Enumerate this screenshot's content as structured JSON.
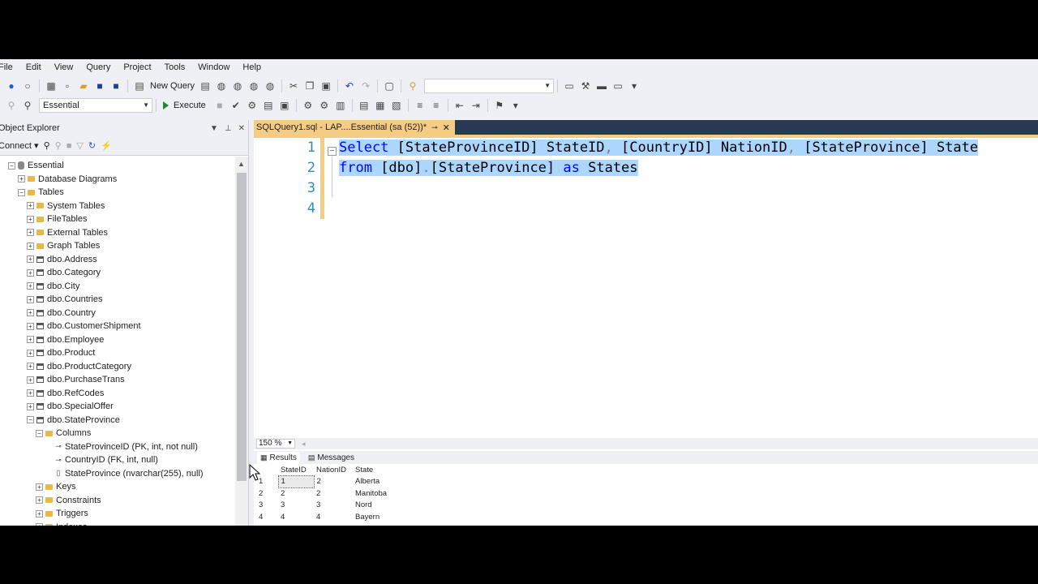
{
  "menu": [
    "File",
    "Edit",
    "View",
    "Query",
    "Project",
    "Tools",
    "Window",
    "Help"
  ],
  "toolbar1": {
    "new_query": "New Query",
    "search_value": ""
  },
  "toolbar2": {
    "database": "Essential",
    "execute": "Execute"
  },
  "object_explorer": {
    "title": "Object Explorer",
    "connect": "Connect",
    "tree": [
      {
        "label": "Essential",
        "level": 1,
        "expander": "-",
        "icon": "database-icon"
      },
      {
        "label": "Database Diagrams",
        "level": 2,
        "expander": "+",
        "icon": "folder-icon"
      },
      {
        "label": "Tables",
        "level": 2,
        "expander": "-",
        "icon": "folder-icon"
      },
      {
        "label": "System Tables",
        "level": 3,
        "expander": "+",
        "icon": "folder-icon"
      },
      {
        "label": "FileTables",
        "level": 3,
        "expander": "+",
        "icon": "folder-icon"
      },
      {
        "label": "External Tables",
        "level": 3,
        "expander": "+",
        "icon": "folder-icon"
      },
      {
        "label": "Graph Tables",
        "level": 3,
        "expander": "+",
        "icon": "folder-icon"
      },
      {
        "label": "dbo.Address",
        "level": 3,
        "expander": "+",
        "icon": "table-icon"
      },
      {
        "label": "dbo.Category",
        "level": 3,
        "expander": "+",
        "icon": "table-icon"
      },
      {
        "label": "dbo.City",
        "level": 3,
        "expander": "+",
        "icon": "table-icon"
      },
      {
        "label": "dbo.Countries",
        "level": 3,
        "expander": "+",
        "icon": "table-icon"
      },
      {
        "label": "dbo.Country",
        "level": 3,
        "expander": "+",
        "icon": "table-icon"
      },
      {
        "label": "dbo.CustomerShipment",
        "level": 3,
        "expander": "+",
        "icon": "table-icon"
      },
      {
        "label": "dbo.Employee",
        "level": 3,
        "expander": "+",
        "icon": "table-icon"
      },
      {
        "label": "dbo.Product",
        "level": 3,
        "expander": "+",
        "icon": "table-icon"
      },
      {
        "label": "dbo.ProductCategory",
        "level": 3,
        "expander": "+",
        "icon": "table-icon"
      },
      {
        "label": "dbo.PurchaseTrans",
        "level": 3,
        "expander": "+",
        "icon": "table-icon"
      },
      {
        "label": "dbo.RefCodes",
        "level": 3,
        "expander": "+",
        "icon": "table-icon"
      },
      {
        "label": "dbo.SpecialOffer",
        "level": 3,
        "expander": "+",
        "icon": "table-icon"
      },
      {
        "label": "dbo.StateProvince",
        "level": 3,
        "expander": "-",
        "icon": "table-icon"
      },
      {
        "label": "Columns",
        "level": 4,
        "expander": "-",
        "icon": "folder-icon"
      },
      {
        "label": "StateProvinceID (PK, int, not null)",
        "level": 5,
        "expander": "",
        "icon": "primary-key-icon"
      },
      {
        "label": "CountryID (FK, int, null)",
        "level": 5,
        "expander": "",
        "icon": "foreign-key-icon"
      },
      {
        "label": "StateProvince (nvarchar(255), null)",
        "level": 5,
        "expander": "",
        "icon": "column-icon"
      },
      {
        "label": "Keys",
        "level": 4,
        "expander": "+",
        "icon": "folder-icon"
      },
      {
        "label": "Constraints",
        "level": 4,
        "expander": "+",
        "icon": "folder-icon"
      },
      {
        "label": "Triggers",
        "level": 4,
        "expander": "+",
        "icon": "folder-icon"
      },
      {
        "label": "Indexes",
        "level": 4,
        "expander": "+",
        "icon": "folder-icon"
      }
    ]
  },
  "editor": {
    "tab_label": "SQLQuery1.sql - LAP....Essential (sa (52))*",
    "line_numbers": [
      "1",
      "2",
      "3",
      "4"
    ],
    "line1": {
      "select": "Select",
      "col1": " [StateProvinceID] StateID",
      "comma1": ",",
      "col2": " [CountryID] NationID",
      "comma2": ",",
      "col3": " [StateProvince] State"
    },
    "line2": {
      "from": "from",
      "schema": " [dbo]",
      "dot": ".",
      "table": "[StateProvince] ",
      "as": "as",
      "alias": " States"
    },
    "zoom": "150 %"
  },
  "results": {
    "tab_results": "Results",
    "tab_messages": "Messages",
    "columns": [
      "StateID",
      "NationID",
      "State"
    ],
    "rows": [
      {
        "n": "1",
        "StateID": "1",
        "NationID": "2",
        "State": "Alberta"
      },
      {
        "n": "2",
        "StateID": "2",
        "NationID": "2",
        "State": "Manitoba"
      },
      {
        "n": "3",
        "StateID": "3",
        "NationID": "3",
        "State": "Nord"
      },
      {
        "n": "4",
        "StateID": "4",
        "NationID": "4",
        "State": "Bayern"
      }
    ]
  },
  "colors": {
    "tab_accent": "#f5cc84",
    "tabbar_bg": "#293955",
    "keyword": "#0000ff",
    "selection": "#add6ff",
    "line_number": "#2b91af"
  }
}
